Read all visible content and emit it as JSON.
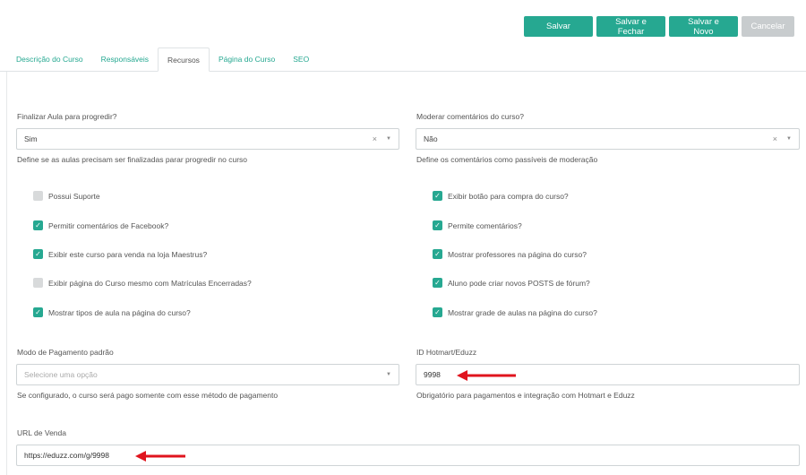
{
  "toolbar": {
    "save": "Salvar",
    "save_close": "Salvar e Fechar",
    "save_new": "Salvar e Novo",
    "cancel": "Cancelar"
  },
  "tabs": [
    {
      "label": "Descrição do Curso",
      "active": false
    },
    {
      "label": "Responsáveis",
      "active": false
    },
    {
      "label": "Recursos",
      "active": true
    },
    {
      "label": "Página do Curso",
      "active": false
    },
    {
      "label": "SEO",
      "active": false
    }
  ],
  "finalize": {
    "label": "Finalizar Aula para progredir?",
    "value": "Sim",
    "help": "Define se as aulas precisam ser finalizadas parar progredir no curso"
  },
  "moderate": {
    "label": "Moderar comentários do curso?",
    "value": "Não",
    "help": "Define os comentários como passíveis de moderação"
  },
  "left_checks": [
    {
      "label": "Possui Suporte",
      "checked": false
    },
    {
      "label": "Permitir comentários de Facebook?",
      "checked": true
    },
    {
      "label": "Exibir este curso para venda na loja Maestrus?",
      "checked": true
    },
    {
      "label": "Exibir página do Curso mesmo com Matrículas Encerradas?",
      "checked": false
    },
    {
      "label": "Mostrar tipos de aula na página do curso?",
      "checked": true
    }
  ],
  "right_checks": [
    {
      "label": "Exibir botão para compra do curso?",
      "checked": true
    },
    {
      "label": "Permite comentários?",
      "checked": true
    },
    {
      "label": "Mostrar professores na página do curso?",
      "checked": true
    },
    {
      "label": "Aluno pode criar novos POSTS de fórum?",
      "checked": true
    },
    {
      "label": "Mostrar grade de aulas na página do curso?",
      "checked": true
    }
  ],
  "payment": {
    "label": "Modo de Pagamento padrão",
    "placeholder": "Selecione uma opção",
    "help": "Se configurado, o curso será pago somente com esse método de pagamento"
  },
  "hotmart": {
    "label": "ID Hotmart/Eduzz",
    "value": "9998",
    "help": "Obrigatório para pagamentos e integração com Hotmart e Eduzz"
  },
  "sales_url": {
    "label": "URL de Venda",
    "value": "https://eduzz.com/g/9998"
  },
  "colors": {
    "accent": "#26a891",
    "cancel": "#c8ccce",
    "annotation_arrow": "#e0141e"
  },
  "icons": {
    "clear": "×",
    "caret": "▼",
    "check": "✓"
  }
}
